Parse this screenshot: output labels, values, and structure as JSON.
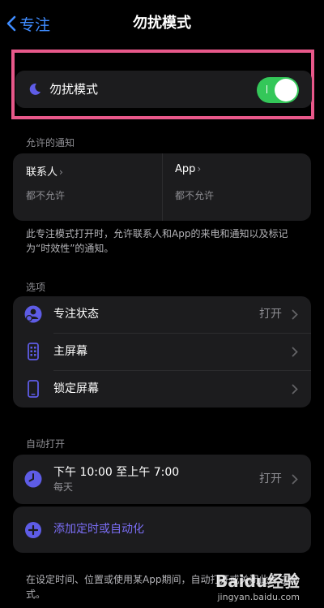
{
  "nav": {
    "back_label": "专注",
    "title": "勿扰模式"
  },
  "dnd": {
    "label": "勿扰模式",
    "toggle_on": true
  },
  "allowed": {
    "heading": "允许的通知",
    "columns": [
      {
        "title": "联系人",
        "status": "都不允许"
      },
      {
        "title": "App",
        "status": "都不允许"
      }
    ],
    "note": "此专注模式打开时，允许联系人和App的来电和通知以及标记为“时效性”的通知。"
  },
  "options": {
    "heading": "选项",
    "items": [
      {
        "label": "专注状态",
        "value": "打开",
        "icon": "focus-status-icon"
      },
      {
        "label": "主屏幕",
        "value": "",
        "icon": "home-screen-icon"
      },
      {
        "label": "锁定屏幕",
        "value": "",
        "icon": "lock-screen-icon"
      }
    ]
  },
  "auto": {
    "heading": "自动打开",
    "schedule_time": "下午 10:00 至上午 7:00",
    "schedule_repeat": "每天",
    "schedule_value": "打开",
    "add_label": "添加定时或自动化",
    "note": "在设定时间、位置或使用某App期间，自动打开或关闭此专注模式。"
  },
  "watermark": {
    "logo": "Baidu经验",
    "site": "jingyan.baidu.com"
  },
  "colors": {
    "accent": "#3f8cff",
    "purple": "#5e5ce6",
    "toggle": "#34c759",
    "highlight": "#e8588a"
  }
}
